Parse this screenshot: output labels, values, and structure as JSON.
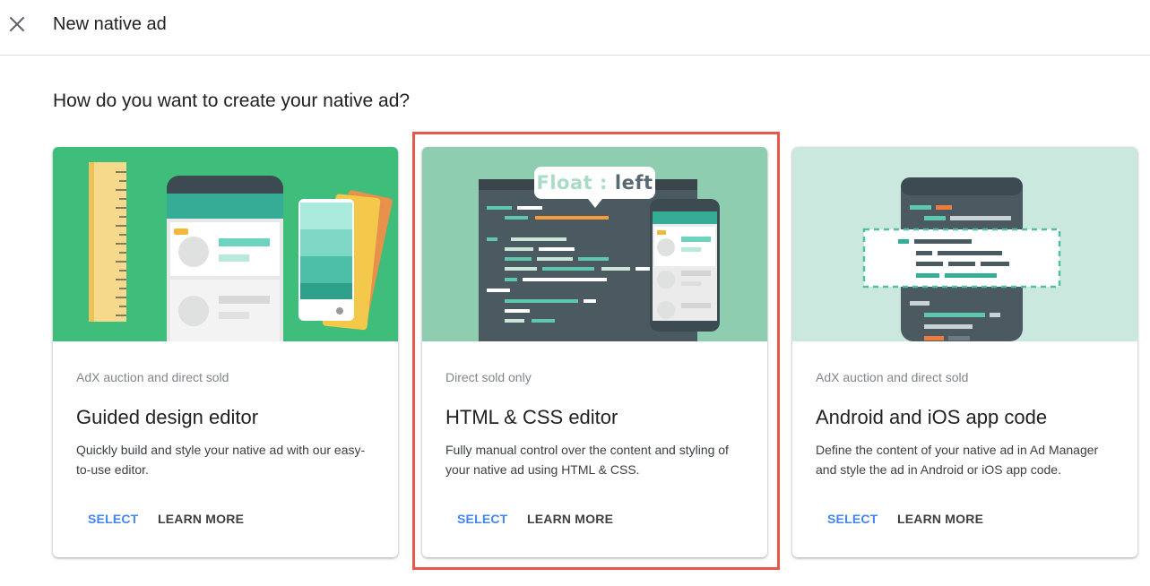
{
  "header": {
    "close_icon": "close-icon",
    "title": "New native ad"
  },
  "question": "How do you want to create your native ad?",
  "cards": [
    {
      "subtitle": "AdX auction and direct sold",
      "title": "Guided design editor",
      "description": "Quickly build and style your native ad with our easy-to-use editor.",
      "select_label": "SELECT",
      "learn_more_label": "LEARN MORE",
      "illustration_bg": "#3fbd7b"
    },
    {
      "subtitle": "Direct sold only",
      "title": "HTML & CSS editor",
      "description": "Fully manual control over the content and styling of your native ad using HTML & CSS.",
      "select_label": "SELECT",
      "learn_more_label": "LEARN MORE",
      "illustration_bg": "#8ecdb0",
      "bubble_key": "Float :",
      "bubble_value": "left",
      "highlighted": true
    },
    {
      "subtitle": "AdX auction and direct sold",
      "title": "Android and iOS app code",
      "description": "Define the content of your native ad in Ad Manager and style the ad in Android or iOS app code.",
      "select_label": "SELECT",
      "learn_more_label": "LEARN MORE",
      "illustration_bg": "#cbe8df"
    }
  ],
  "colors": {
    "accent": "#4285f4",
    "highlight": "#e8574b"
  }
}
